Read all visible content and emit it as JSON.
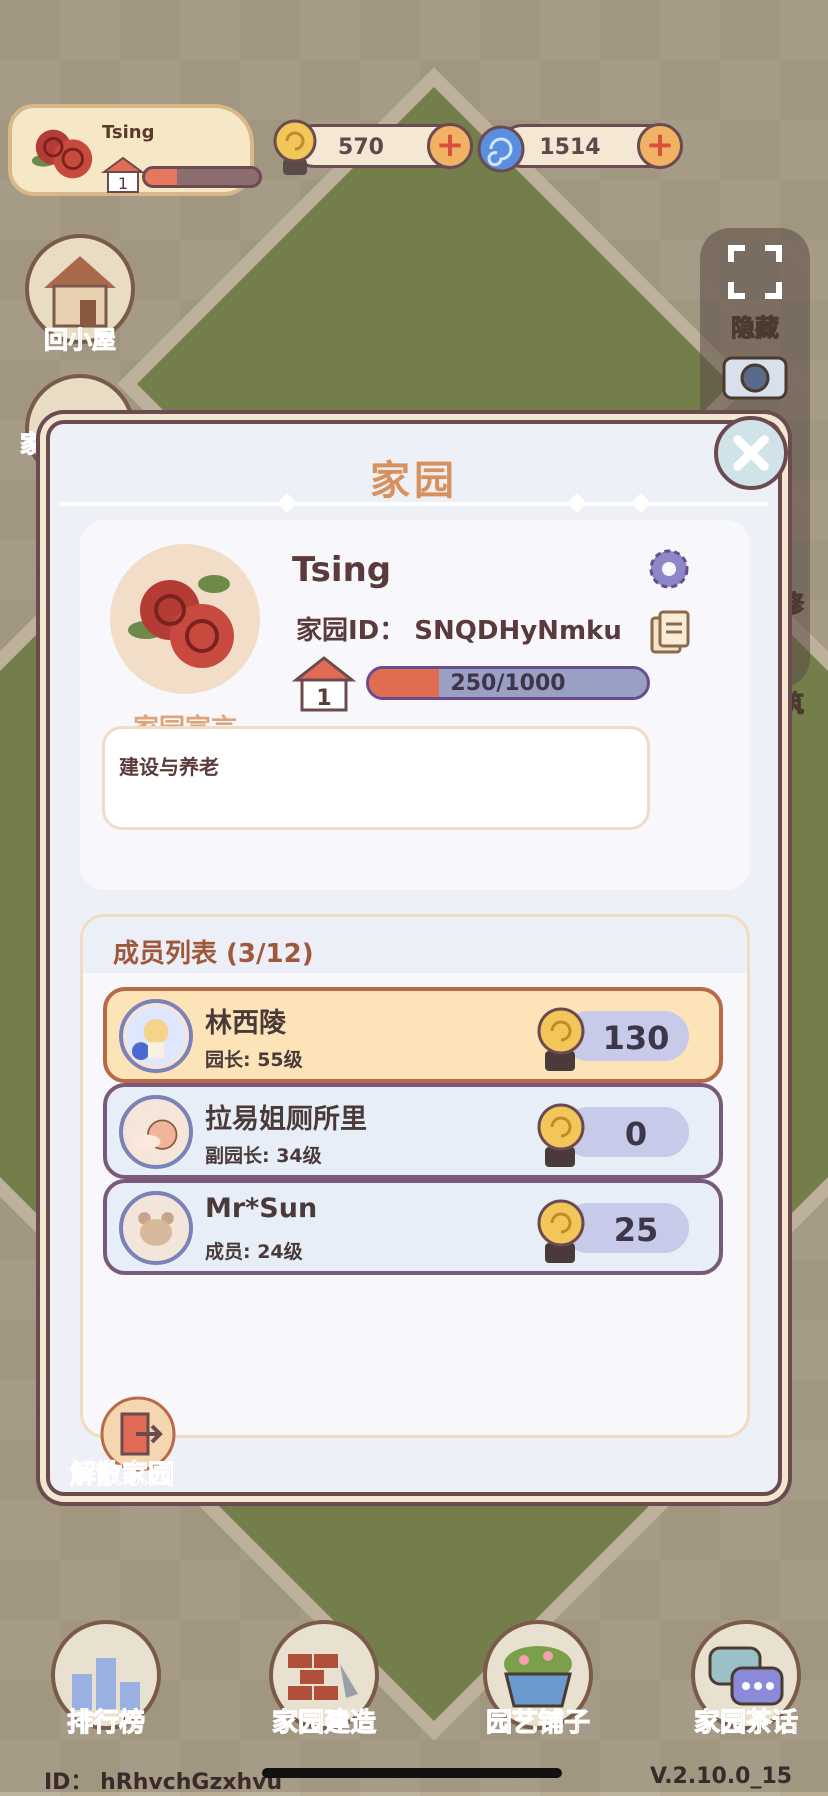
{
  "profile": {
    "name": "Tsing",
    "level": "1",
    "exp_fraction": 0.28
  },
  "currencies": [
    {
      "icon": "snail-coin-icon",
      "value": "570"
    },
    {
      "icon": "spiral-gem-icon",
      "value": "1514"
    }
  ],
  "left_menu": {
    "back_home": "回小屋",
    "family_partial": "家"
  },
  "right_menu": {
    "hide": "隐藏",
    "photo": "拍照",
    "repair_partial": "修",
    "build_partial": "筑"
  },
  "dialog": {
    "title": "家园",
    "home_name": "Tsing",
    "home_id": "家园ID： SNQDHyNmku",
    "home_level": "1",
    "exp_text": "250/1000",
    "exp_fraction": 0.25,
    "declaration_label": "家园宣言",
    "declaration_text": "建设与养老",
    "members_title": "成员列表 (3/12)",
    "members": [
      {
        "name": "林西陵",
        "role": "园长: 55级",
        "score": "130",
        "avatar": "knight-avatar"
      },
      {
        "name": "拉易姐厕所里",
        "role": "副园长: 34级",
        "score": "0",
        "avatar": "snail-avatar"
      },
      {
        "name": "Mr*Sun",
        "role": "成员: 24级",
        "score": "25",
        "avatar": "bear-avatar"
      }
    ],
    "dissolve_label": "解散家园"
  },
  "bottom_nav": [
    {
      "label": "排行榜",
      "icon": "ranking-icon"
    },
    {
      "label": "家园建造",
      "icon": "brick-build-icon"
    },
    {
      "label": "园艺铺子",
      "icon": "flower-pot-icon"
    },
    {
      "label": "家园茶话",
      "icon": "chat-icon"
    }
  ],
  "footer": {
    "user_id": "ID： hRhvchGzxhvu",
    "version": "V.2.10.0_15"
  }
}
